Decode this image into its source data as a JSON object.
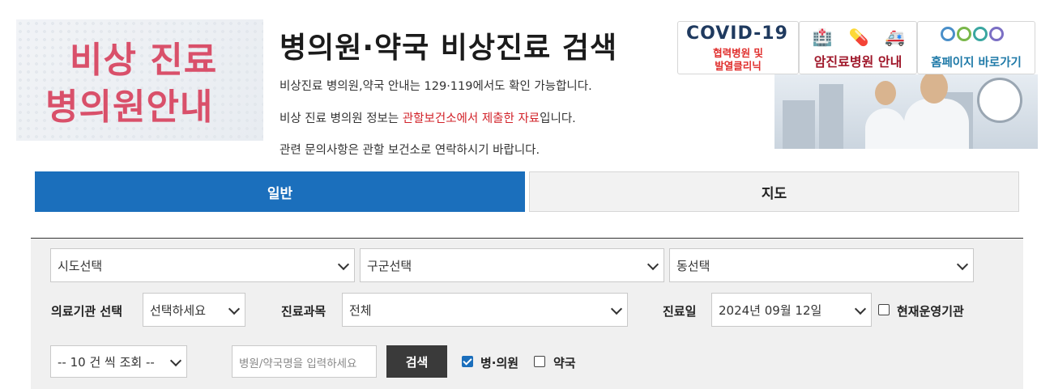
{
  "header": {
    "logo_line1": "비상 진료",
    "logo_line2": "병의원안내",
    "title": "병의원·약국 비상진료 검색",
    "desc1": "비상진료 병의원,약국 안내는 129·119에서도 확인 가능합니다.",
    "desc2_pre": "비상 진료 병의원 정보는 ",
    "desc2_red": "관할보건소에서 제출한 자료",
    "desc2_post": "입니다.",
    "desc3": "관련 문의사항은 관할 보건소로 연락하시기 바랍니다."
  },
  "banners": {
    "covid_title": "COVID-19",
    "covid_sub1": "협력병원 및",
    "covid_sub2": "발열클리닉",
    "cancer_label": "암진료병원 안내",
    "home_label": "홈페이지 바로가기"
  },
  "tabs": {
    "general": "일반",
    "map": "지도"
  },
  "filters": {
    "sido": "시도선택",
    "gugun": "구군선택",
    "dong": "동선택",
    "institution_label": "의료기관 선택",
    "institution_value": "선택하세요",
    "department_label": "진료과목",
    "department_value": "전체",
    "date_label": "진료일",
    "date_value": "2024년 09월 12일",
    "operating_label": "현재운영기관",
    "page_size": "-- 10 건 씩 조회 --",
    "search_placeholder": "병원/약국명을 입력하세요",
    "search_button": "검색",
    "hospital_label": "병·의원",
    "pharmacy_label": "약국"
  },
  "state": {
    "operating_checked": false,
    "hospital_checked": true,
    "pharmacy_checked": false
  },
  "colors": {
    "accent_blue": "#1b6fbc",
    "logo_pink": "#d9506a",
    "notice_red": "#d2232a"
  }
}
